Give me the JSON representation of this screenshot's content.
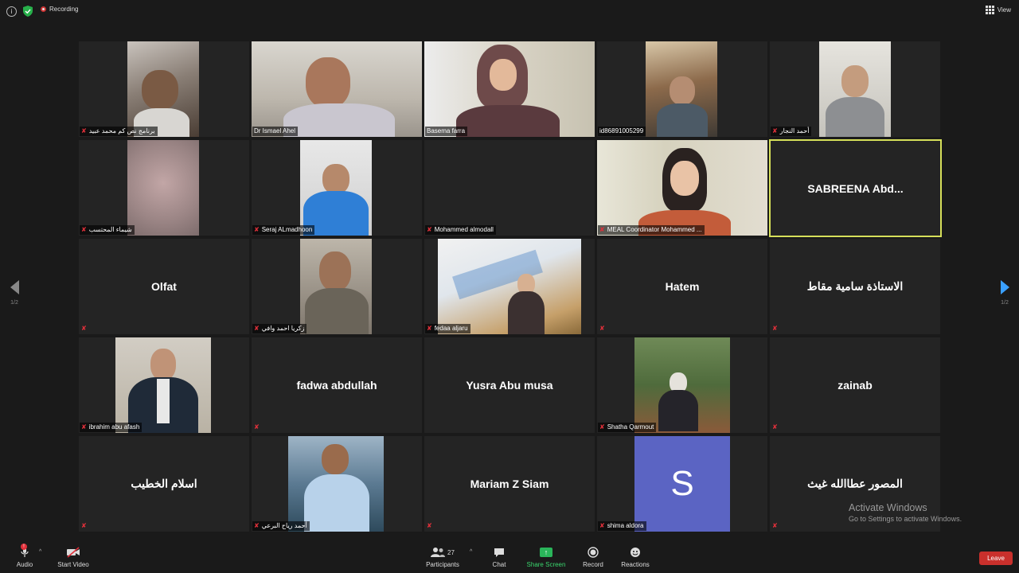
{
  "topbar": {
    "recording_label": "Recording",
    "view_label": "View"
  },
  "pager": {
    "left_page": "1/2",
    "right_page": "1/2"
  },
  "tiles": [
    {
      "name": "برنامج نص كم محمد عبيد"
    },
    {
      "name": "Dr Ismael Ahel"
    },
    {
      "name": "Basema farra"
    },
    {
      "name": "id86891005299"
    },
    {
      "name": "أحمد النجار"
    },
    {
      "name": "شيماء المحتسب"
    },
    {
      "name": "Seraj ALmadhoon"
    },
    {
      "name": "Mohammed almodall"
    },
    {
      "name": "MEAL Coordinator Mohammed ..."
    },
    {
      "display": "SABREENA  Abd..."
    },
    {
      "display": "Olfat"
    },
    {
      "name": "زكريا احمد وافي"
    },
    {
      "name": "fedaa aljaru"
    },
    {
      "display": "Hatem"
    },
    {
      "display": "الاستاذة سامية مقاط"
    },
    {
      "name": "ibrahim abu afash"
    },
    {
      "display": "fadwa abdullah"
    },
    {
      "display": "Yusra Abu musa"
    },
    {
      "name": "Shatha Qarmout"
    },
    {
      "display": "zainab"
    },
    {
      "display": "اسلام الخطيب"
    },
    {
      "name": "أحمد رياح البرعي"
    },
    {
      "display": "Mariam Z Siam"
    },
    {
      "name": "shima aldora",
      "avatar_letter": "S"
    },
    {
      "display": "المصور عطاالله غيث"
    }
  ],
  "watermark": {
    "title": "Activate Windows",
    "subtitle": "Go to Settings to activate Windows."
  },
  "toolbar": {
    "audio": "Audio",
    "start_video": "Start Video",
    "participants": "Participants",
    "participants_count": "27",
    "chat": "Chat",
    "share_screen": "Share Screen",
    "record": "Record",
    "reactions": "Reactions",
    "leave": "Leave"
  },
  "colors": {
    "active_speaker": "#d6e05a",
    "leave": "#c9302c",
    "share": "#2ab55a",
    "avatar": "#5b64c3",
    "pager_active": "#3aa0ff"
  }
}
